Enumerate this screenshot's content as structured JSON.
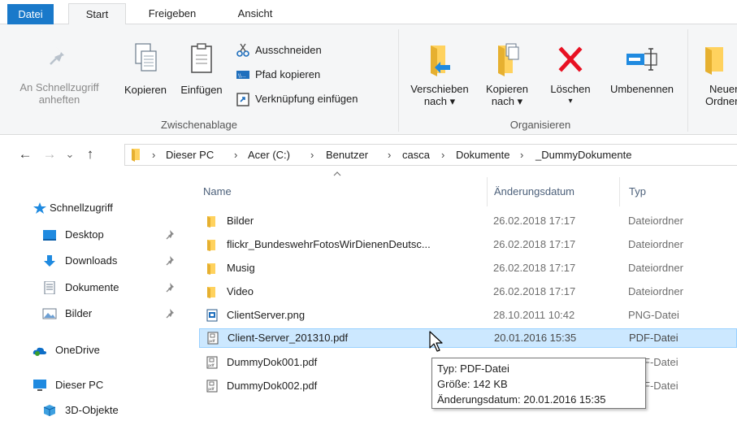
{
  "ribbon": {
    "tabs": [
      "Datei",
      "Start",
      "Freigeben",
      "Ansicht"
    ],
    "pin_label_1": "An Schnellzugriff",
    "pin_label_2": "anheften",
    "copy_label": "Kopieren",
    "paste_label": "Einfügen",
    "cut_label": "Ausschneiden",
    "copy_path_label": "Pfad kopieren",
    "paste_shortcut_label": "Verknüpfung einfügen",
    "clipboard_group": "Zwischenablage",
    "move_to_label_1": "Verschieben",
    "move_to_label_2": "nach ▾",
    "copy_to_label_1": "Kopieren",
    "copy_to_label_2": "nach ▾",
    "delete_label": "Löschen",
    "delete_arrow": "▾",
    "rename_label": "Umbenennen",
    "organize_group": "Organisieren",
    "new_folder_label_1": "Neuer",
    "new_folder_label_2": "Ordner"
  },
  "address": {
    "back": "←",
    "forward": "→",
    "recent": "⌄",
    "up": "↑",
    "separator": "›",
    "crumbs": [
      "Dieser PC",
      "Acer (C:)",
      "Benutzer",
      "casca",
      "Dokumente",
      "_DummyDokumente"
    ]
  },
  "nav": {
    "quick_access": "Schnellzugriff",
    "desktop": "Desktop",
    "downloads": "Downloads",
    "documents": "Dokumente",
    "pictures": "Bilder",
    "onedrive": "OneDrive",
    "this_pc": "Dieser PC",
    "objects3d": "3D-Objekte"
  },
  "columns": {
    "name": "Name",
    "date": "Änderungsdatum",
    "type": "Typ"
  },
  "files": [
    {
      "name": "Bilder",
      "date": "26.02.2018 17:17",
      "type": "Dateiordner",
      "icon": "folder-icon"
    },
    {
      "name": "flickr_BundeswehrFotosWirDienenDeutsc...",
      "date": "26.02.2018 17:17",
      "type": "Dateiordner",
      "icon": "folder-icon"
    },
    {
      "name": "Musig",
      "date": "26.02.2018 17:17",
      "type": "Dateiordner",
      "icon": "folder-icon"
    },
    {
      "name": "Video",
      "date": "26.02.2018 17:17",
      "type": "Dateiordner",
      "icon": "folder-icon"
    },
    {
      "name": "ClientServer.png",
      "date": "28.10.2011 10:42",
      "type": "PNG-Datei",
      "icon": "png-file-icon"
    },
    {
      "name": "Client-Server_201310.pdf",
      "date": "20.01.2016 15:35",
      "type": "PDF-Datei",
      "icon": "pdf-file-icon"
    },
    {
      "name": "DummyDok001.pdf",
      "date": "",
      "type": "F-Datei",
      "icon": "pdf-file-icon"
    },
    {
      "name": "DummyDok002.pdf",
      "date": "",
      "type": "F-Datei",
      "icon": "pdf-file-icon"
    }
  ],
  "tooltip": {
    "type_line": "Typ: PDF-Datei",
    "size_line": "Größe: 142 KB",
    "date_line": "Änderungsdatum: 20.01.2016 15:35"
  },
  "colors": {
    "accent": "#1979ca",
    "hover_row": "#cce8ff",
    "folder": "#ffd25e",
    "delete_red": "#e81123"
  }
}
